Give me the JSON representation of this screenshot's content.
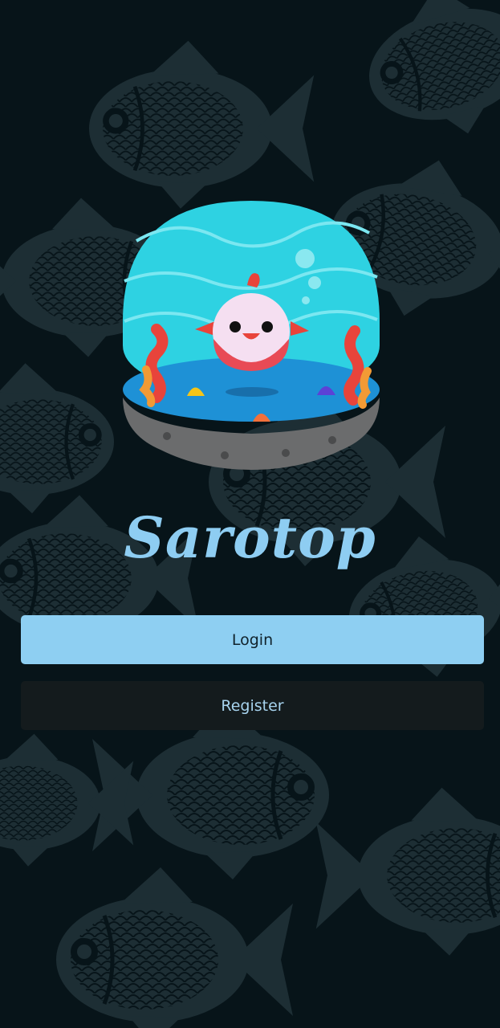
{
  "app": {
    "name": "Sarotop"
  },
  "actions": {
    "login_label": "Login",
    "register_label": "Register"
  },
  "theme": {
    "background": "#071419",
    "pattern_color": "#1f3137",
    "accent": "#8ecff2",
    "register_bg": "#141b1d"
  },
  "icons": {
    "logo": "aquarium-fish-icon",
    "background": "fish-pattern"
  }
}
